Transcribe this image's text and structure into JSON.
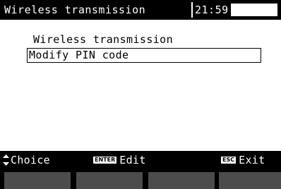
{
  "header": {
    "title": "Wireless transmission",
    "clock": "21:59",
    "battery_icon": "battery-icon",
    "battery_level": 0
  },
  "menu": {
    "items": [
      {
        "label": "Wireless transmission",
        "selected": false
      },
      {
        "label": "Modify PIN code",
        "selected": true
      }
    ]
  },
  "footer": {
    "choice_icon": "up-down-arrow-icon",
    "choice_label": "Choice",
    "edit_key": "ENTER",
    "edit_label": "Edit",
    "exit_key": "ESC",
    "exit_label": "Exit"
  },
  "softkeys": {
    "count": 4,
    "color": "#4c4c4c"
  },
  "colors": {
    "background": "#ffffff",
    "bar": "#000000",
    "text": "#000000",
    "softkey": "#4c4c4c"
  }
}
